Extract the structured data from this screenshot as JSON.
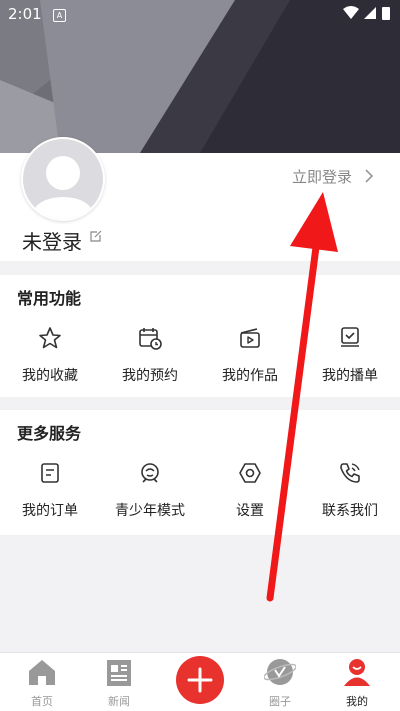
{
  "statusbar": {
    "time": "2:01",
    "notif": "A"
  },
  "profile": {
    "name": "未登录",
    "login_link": "立即登录"
  },
  "sections": [
    {
      "title": "常用功能",
      "items": [
        {
          "label": "我的收藏",
          "icon": "star-icon"
        },
        {
          "label": "我的预约",
          "icon": "calendar-clock-icon"
        },
        {
          "label": "我的作品",
          "icon": "video-clip-icon"
        },
        {
          "label": "我的播单",
          "icon": "playlist-icon"
        }
      ]
    },
    {
      "title": "更多服务",
      "items": [
        {
          "label": "我的订单",
          "icon": "order-icon"
        },
        {
          "label": "青少年模式",
          "icon": "youth-icon"
        },
        {
          "label": "设置",
          "icon": "settings-icon"
        },
        {
          "label": "联系我们",
          "icon": "phone-icon"
        }
      ]
    }
  ],
  "tabbar": {
    "items": [
      {
        "label": "首页",
        "icon": "home-icon"
      },
      {
        "label": "新闻",
        "icon": "news-icon"
      },
      {
        "label": "",
        "icon": "plus-icon"
      },
      {
        "label": "圈子",
        "icon": "circle-planet-icon"
      },
      {
        "label": "我的",
        "icon": "profile-icon"
      }
    ],
    "active": "我的"
  },
  "colors": {
    "accent": "#e8322e",
    "header_dark": "#2e2d37",
    "header_light": "#8a8b94"
  }
}
